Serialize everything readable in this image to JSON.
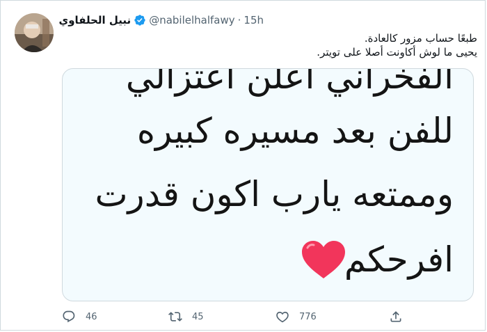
{
  "tweet": {
    "author_name": "نبيل الحلفاوي",
    "handle": "@nabilelhalfawy",
    "separator": "·",
    "time": "15h",
    "text_lines": [
      "طبعًا حساب مزور كالعادة.",
      "يحيى ما لوش أكاونت أصلا على تويتر."
    ]
  },
  "media": {
    "lines": [
      "الفخراني أعلن اعتزالي",
      "للفن بعد مسيره كبيره",
      "وممتعه يارب اكون قدرت",
      "افرحكم"
    ],
    "heart_color": "#f2355b"
  },
  "actions": {
    "reply_count": "46",
    "retweet_count": "45",
    "like_count": "776"
  },
  "colors": {
    "verified_blue": "#1d9bf0",
    "secondary_text": "#536471"
  }
}
